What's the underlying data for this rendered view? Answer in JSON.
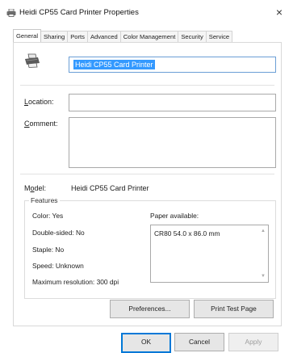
{
  "window": {
    "title": "Heidi CP55 Card Printer Properties",
    "close_glyph": "×"
  },
  "tabs": [
    {
      "label": "General"
    },
    {
      "label": "Sharing"
    },
    {
      "label": "Ports"
    },
    {
      "label": "Advanced"
    },
    {
      "label": "Color Management"
    },
    {
      "label": "Security"
    },
    {
      "label": "Service"
    }
  ],
  "general": {
    "printer_name": "Heidi CP55 Card Printer",
    "location_label_first": "L",
    "location_label_rest": "ocation:",
    "location_value": "",
    "comment_label_first": "C",
    "comment_label_rest": "omment:",
    "comment_value": "",
    "model_label_first": "M",
    "model_label_o": "o",
    "model_label_rest": "del:",
    "model_value": "Heidi CP55 Card Printer"
  },
  "features": {
    "legend": "Features",
    "color": "Color: Yes",
    "double_sided": "Double-sided: No",
    "staple": "Staple: No",
    "speed": "Speed: Unknown",
    "max_resolution": "Maximum resolution: 300 dpi",
    "paper_label": "Paper available:",
    "paper_items": [
      "CR80 54.0 x 86.0 mm"
    ]
  },
  "buttons": {
    "preferences": "Preferences...",
    "print_test_page": "Print Test Page",
    "ok": "OK",
    "cancel": "Cancel",
    "apply": "Apply"
  },
  "colors": {
    "selection": "#3399ff",
    "focus_border": "#0078d7"
  }
}
